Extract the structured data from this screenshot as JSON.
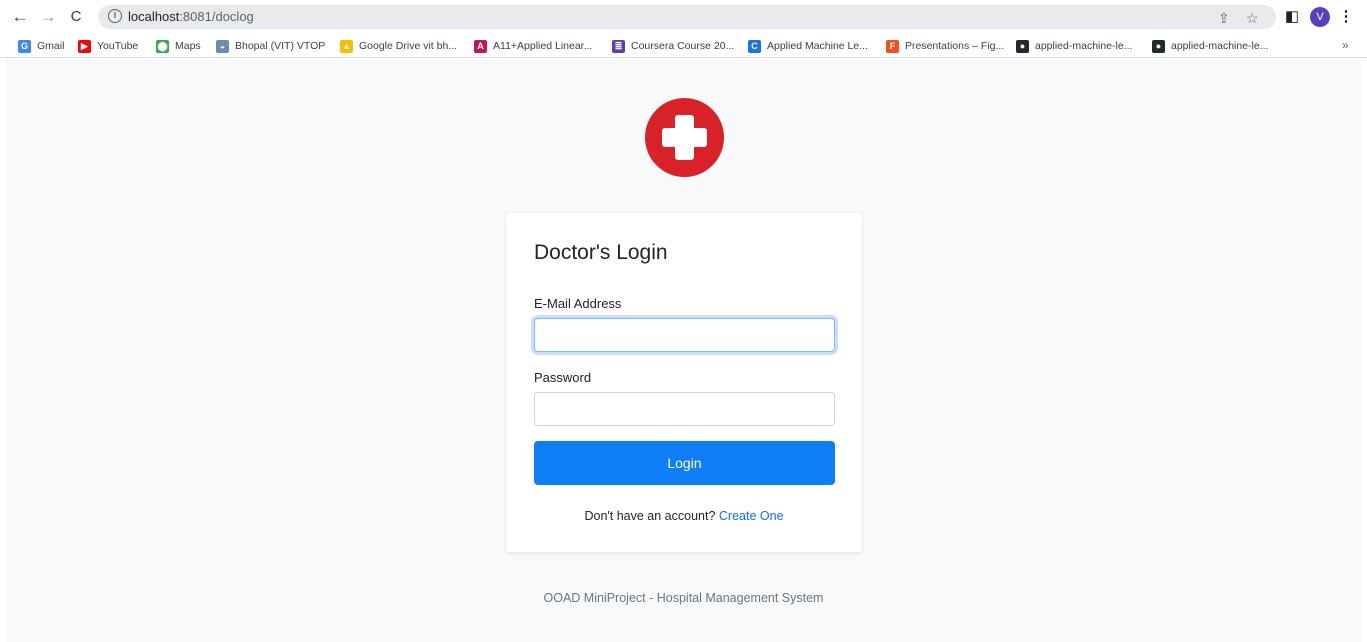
{
  "browser": {
    "url_host": "localhost",
    "url_port": ":8081",
    "url_path": "/doclog",
    "profile_initial": "V"
  },
  "bookmarks": [
    {
      "label": "Gmail",
      "icon": "google-icon",
      "color": "#4285f4",
      "glyph": "G"
    },
    {
      "label": "YouTube",
      "icon": "youtube-icon",
      "color": "#ff0000",
      "glyph": "▶"
    },
    {
      "label": "Maps",
      "icon": "maps-icon",
      "color": "#34a853",
      "glyph": "⬤"
    },
    {
      "label": "Bhopal (VIT) VTOP",
      "icon": "vtop-icon",
      "color": "#6b8bb3",
      "glyph": "◒"
    },
    {
      "label": "Google Drive vit bh...",
      "icon": "drive-icon",
      "color": "#fbbc04",
      "glyph": "▲"
    },
    {
      "label": "A11+Applied Linear...",
      "icon": "classroom-icon",
      "color": "#c2185b",
      "glyph": "A"
    },
    {
      "label": "Coursera Course 20...",
      "icon": "sheets-icon",
      "color": "#5c3fb8",
      "glyph": "≣"
    },
    {
      "label": "Applied Machine Le...",
      "icon": "coursera-icon",
      "color": "#1a73e8",
      "glyph": "C"
    },
    {
      "label": "Presentations – Fig...",
      "icon": "figma-icon",
      "color": "#f24e1e",
      "glyph": "F"
    },
    {
      "label": "applied-machine-le...",
      "icon": "github-icon",
      "color": "#24292f",
      "glyph": "●"
    },
    {
      "label": "applied-machine-le...",
      "icon": "github-icon",
      "color": "#24292f",
      "glyph": "●"
    }
  ],
  "bookmarks_more": "»",
  "login": {
    "title": "Doctor's Login",
    "email_label": "E-Mail Address",
    "email_value": "",
    "password_label": "Password",
    "password_value": "",
    "button_label": "Login",
    "signup_prompt": "Don't have an account?",
    "signup_link": "Create One"
  },
  "footer": "OOAD MiniProject - Hospital Management System",
  "colors": {
    "accent": "#0d7ef5",
    "logo_red": "#d92128",
    "link": "#0d6efd"
  }
}
